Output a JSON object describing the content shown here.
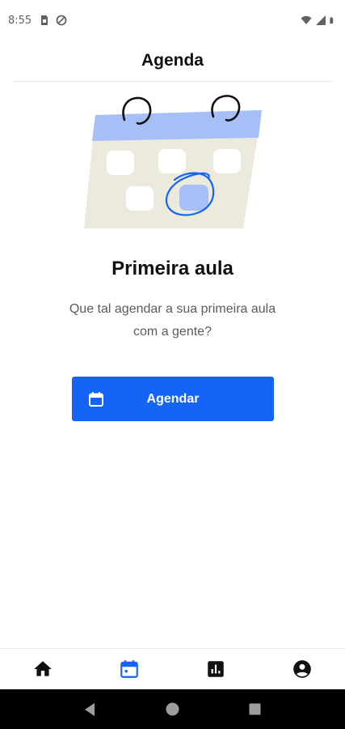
{
  "status_bar": {
    "time": "8:55",
    "icons_left": [
      "sim-card-icon",
      "data-saver-icon"
    ],
    "icons_right": [
      "wifi-icon",
      "signal-icon",
      "battery-icon"
    ]
  },
  "header": {
    "title": "Agenda"
  },
  "empty_state": {
    "illustration": "calendar-illustration",
    "title": "Primeira aula",
    "description": "Que tal agendar a sua primeira aula com a gente?"
  },
  "cta": {
    "label": "Agendar",
    "icon": "calendar-icon",
    "color": "#1664f5"
  },
  "bottom_nav": {
    "tabs": [
      {
        "name": "home",
        "icon": "home-icon",
        "active": false
      },
      {
        "name": "agenda",
        "icon": "calendar-icon",
        "active": true
      },
      {
        "name": "stats",
        "icon": "bar-chart-icon",
        "active": false
      },
      {
        "name": "profile",
        "icon": "account-icon",
        "active": false
      }
    ],
    "active_color": "#1664f5",
    "inactive_color": "#111111"
  },
  "system_nav": {
    "buttons": [
      "back-icon",
      "home-circle-icon",
      "recents-icon"
    ]
  }
}
